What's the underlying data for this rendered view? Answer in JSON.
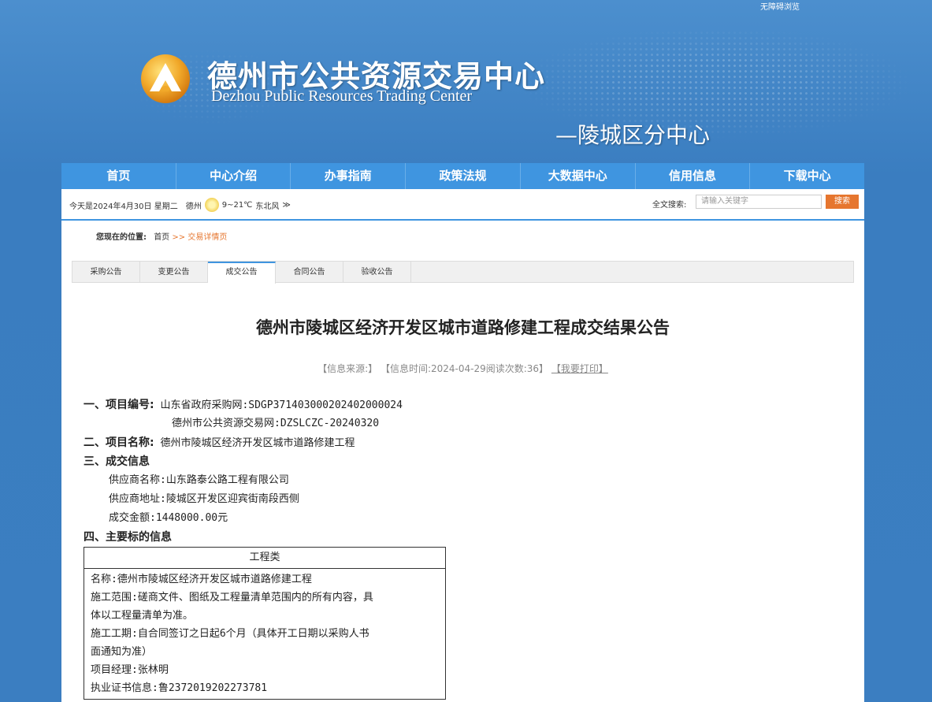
{
  "header": {
    "accessibility": "无障碍浏览",
    "title_cn": "德州市公共资源交易中心",
    "title_en": "Dezhou Public Resources Trading Center",
    "sub_center": "—陵城区分中心"
  },
  "nav": {
    "items": [
      "首页",
      "中心介绍",
      "办事指南",
      "政策法规",
      "大数据中心",
      "信用信息",
      "下载中心"
    ]
  },
  "infobar": {
    "date": "今天是2024年4月30日  星期二",
    "city": "德州",
    "temp": "9~21℃",
    "wind": "东北风",
    "more": "≫",
    "search_label": "全文搜索:",
    "search_placeholder": "请输入关键字",
    "search_button": "搜索"
  },
  "breadcrumb": {
    "label": "您现在的位置:",
    "home": "首页",
    "sep": ">>",
    "current": "交易详情页"
  },
  "tabs": [
    "采购公告",
    "变更公告",
    "成交公告",
    "合同公告",
    "验收公告"
  ],
  "article": {
    "title": "德州市陵城区经济开发区城市道路修建工程成交结果公告",
    "meta_source": "【信息来源:】",
    "meta_time": "【信息时间:2024-04-29阅读次数:36】",
    "meta_print": "【我要打印】",
    "lines": {
      "l1_num": "一、项目编号:",
      "l1_val": "山东省政府采购网:SDGP371403000202402000024",
      "l2_val": "德州市公共资源交易网:DZSLCZC-20240320",
      "l3_num": "二、项目名称:",
      "l3_val": "德州市陵城区经济开发区城市道路修建工程",
      "l4_num": "三、成交信息",
      "l5_val": "供应商名称:山东路泰公路工程有限公司",
      "l6_val": "供应商地址:陵城区开发区迎宾街南段西侧",
      "l7_val": "成交金额:1448000.00元",
      "l8_num": "四、主要标的信息"
    },
    "table": {
      "head": "工程类",
      "name": "名称:德州市陵城区经济开发区城市道路修建工程",
      "scope_1": "施工范围:磋商文件、图纸及工程量清单范围内的所有内容，具",
      "scope_2": "体以工程量清单为准。",
      "period_1": "施工工期:自合同签订之日起6个月（具体开工日期以采购人书",
      "period_2": "面通知为准）",
      "manager": "项目经理:张林明",
      "cert": "执业证书信息:鲁2372019202273781"
    }
  }
}
